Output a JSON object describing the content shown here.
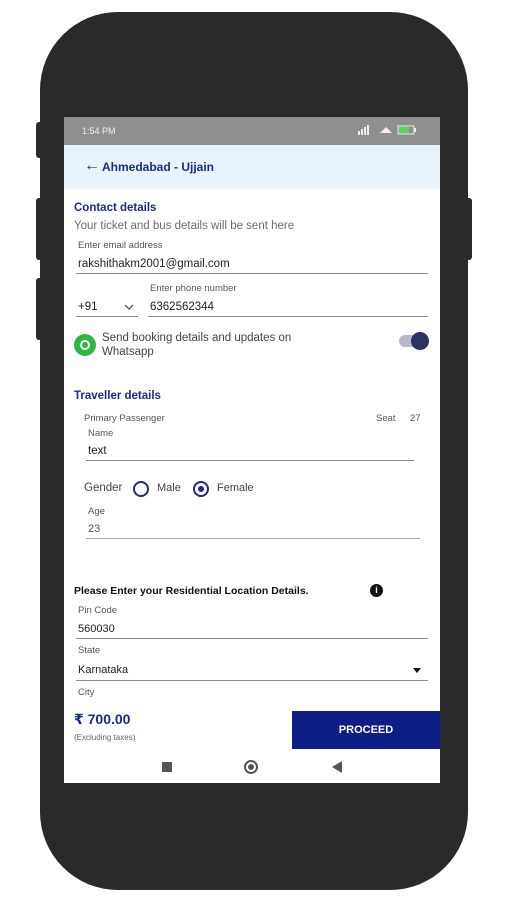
{
  "status_bar": {
    "time": "1:54 PM",
    "battery": "▮"
  },
  "header": {
    "back_glyph": "←",
    "route": "Ahmedabad - Ujjain"
  },
  "contact": {
    "title": "Contact details",
    "subtitle": "Your ticket and bus details will be sent here",
    "email_label": "Enter email address",
    "email_value": "rakshithakm2001@gmail.com",
    "country_code": "+91",
    "phone_label": "Enter phone number",
    "phone_value": "6362562344",
    "whatsapp_text_line1": "Send booking details and updates on",
    "whatsapp_text_line2": "Whatsapp",
    "whatsapp_toggle_on": true
  },
  "traveller": {
    "title": "Traveller details",
    "primary_label": "Primary Passenger",
    "seat_label": "Seat",
    "seat_number": "27",
    "name_label": "Name",
    "name_value": "text",
    "gender_label": "Gender",
    "gender_options": [
      "Male",
      "Female"
    ],
    "gender_selected": "Female",
    "age_label": "Age",
    "age_value": "23"
  },
  "residential": {
    "title": "Please Enter your Residential Location Details.",
    "info_glyph": "i",
    "pin_label": "Pin Code",
    "pin_value": "560030",
    "state_label": "State",
    "state_value": "Karnataka",
    "city_label": "City"
  },
  "footer": {
    "price": "₹ 700.00",
    "price_note": "(Excluding taxes)",
    "proceed_label": "PROCEED"
  },
  "colors": {
    "accent": "#1b2a88",
    "proceed_bg": "#0f1e86",
    "whatsapp": "#2bb741"
  }
}
